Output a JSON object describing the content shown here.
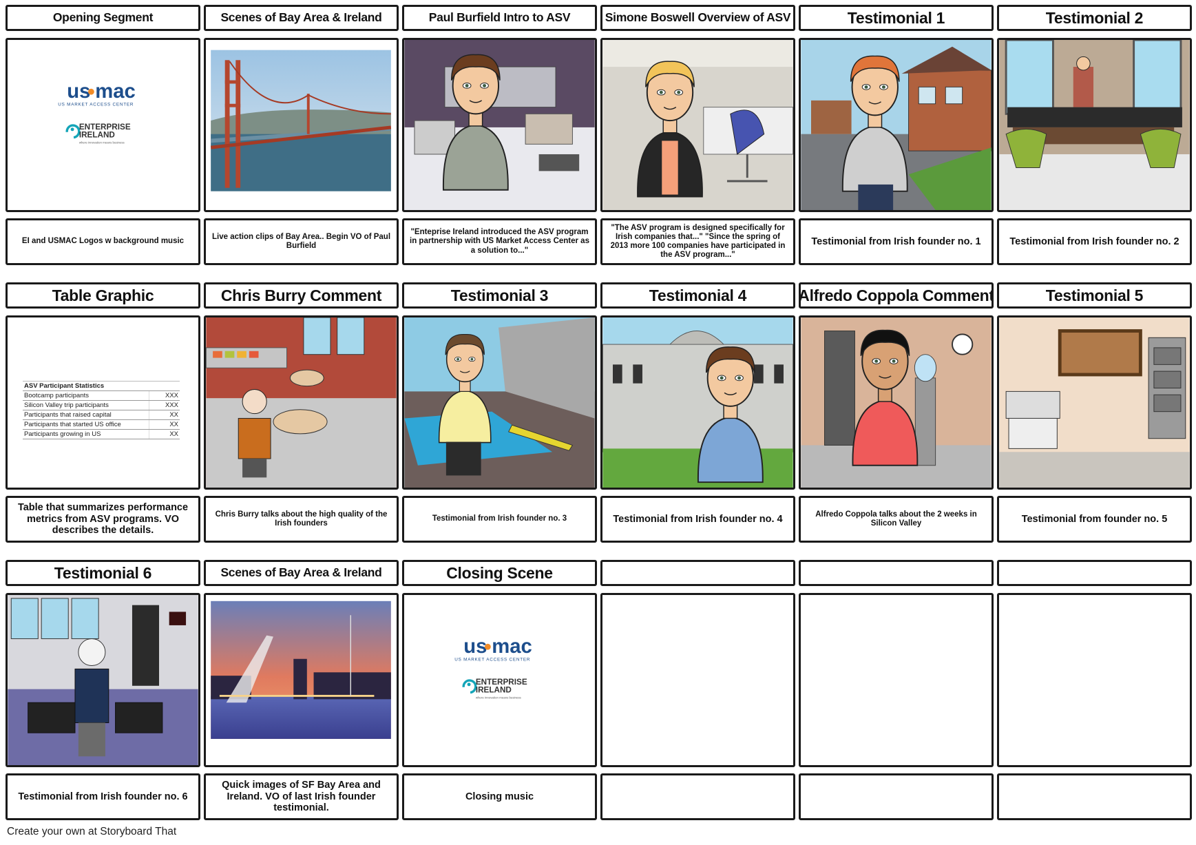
{
  "colors": {
    "usmac_blue": "#1d4e8c",
    "usmac_orange": "#f28c28",
    "enterprise_teal": "#14a5b8",
    "border": "#1a1a1a"
  },
  "logos": {
    "usmac": {
      "word_left": "us",
      "word_right": "mac",
      "tagline": "US MARKET ACCESS CENTER"
    },
    "enterprise": {
      "line1": "ENTERPRISE",
      "line2": "IRELAND",
      "tagline": "where innovation means business"
    }
  },
  "cells": [
    {
      "title": "Opening Segment",
      "caption": "EI and USMAC Logos w background music",
      "scene": "logos"
    },
    {
      "title": "Scenes of Bay Area & Ireland",
      "caption": "Live action clips of Bay Area.. Begin VO of Paul Burfield",
      "scene": "golden-gate-photo"
    },
    {
      "title": "Paul Burfield Intro to ASV",
      "caption": "\"Enteprise Ireland introduced the ASV program in partnership with US Market Access Center as a solution to...\"",
      "scene": "office-man"
    },
    {
      "title": "Simone Boswell Overview of ASV",
      "caption": "\"The ASV program is designed specifically for Irish companies that...\" \"Since the spring of 2013 more 100 companies have participated in the ASV program...\"",
      "scene": "office-woman"
    },
    {
      "title": "Testimonial 1",
      "caption": "Testimonial from Irish founder no. 1",
      "scene": "street-man"
    },
    {
      "title": "Testimonial 2",
      "caption": "Testimonial from Irish founder no. 2",
      "scene": "meeting-room"
    },
    {
      "title": "Table Graphic",
      "caption": "Table that summarizes performance metrics from ASV programs. VO describes the details.",
      "scene": "table"
    },
    {
      "title": "Chris Burry Comment",
      "caption": "Chris Burry talks about the high quality of the Irish founders",
      "scene": "cafeteria-man"
    },
    {
      "title": "Testimonial 3",
      "caption": "Testimonial from Irish founder no. 3",
      "scene": "pool-woman"
    },
    {
      "title": "Testimonial 4",
      "caption": "Testimonial from Irish founder no. 4",
      "scene": "building-man"
    },
    {
      "title": "Alfredo Coppola Comment",
      "caption": "Alfredo Coppola talks about the 2 weeks in Silicon Valley",
      "scene": "office-water-cooler"
    },
    {
      "title": "Testimonial 5",
      "caption": "Testimonial from founder no. 5",
      "scene": "copier-room"
    },
    {
      "title": "Testimonial 6",
      "caption": "Testimonial from Irish founder no. 6",
      "scene": "waiting-room"
    },
    {
      "title": "Scenes of Bay Area & Ireland",
      "caption": "Quick images of SF Bay Area and Ireland. VO of last Irish founder testimonial.",
      "scene": "dublin-photo"
    },
    {
      "title": "Closing Scene",
      "caption": "Closing music",
      "scene": "logos"
    },
    {
      "title": "",
      "caption": "",
      "scene": "empty"
    },
    {
      "title": "",
      "caption": "",
      "scene": "empty"
    },
    {
      "title": "",
      "caption": "",
      "scene": "empty"
    }
  ],
  "stats_table": {
    "header": "ASV Participant Statistics",
    "rows": [
      {
        "label": "Bootcamp participants",
        "value": "XXX"
      },
      {
        "label": "Silicon Valley trip participants",
        "value": "XXX"
      },
      {
        "label": "Participants that raised capital",
        "value": "XX"
      },
      {
        "label": "Participants that started US office",
        "value": "XX"
      },
      {
        "label": "Participants growing in US",
        "value": "XX"
      }
    ]
  },
  "footer": "Create your own at Storyboard That"
}
